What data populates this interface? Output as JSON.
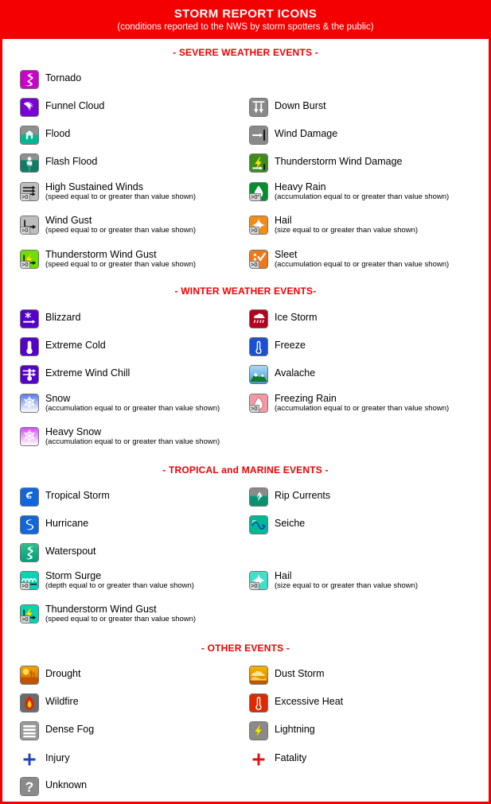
{
  "header": {
    "title": "STORM REPORT ICONS",
    "subtitle": "(conditions reported to the NWS by storm spotters & the public)",
    "bg_color": "#f40000",
    "text_color": "#ffffff"
  },
  "section_head_color": "#ee0000",
  "sections": [
    {
      "id": "severe",
      "heading": "- SEVERE WEATHER EVENTS -",
      "left": [
        {
          "name": "Tornado",
          "sub": "",
          "icon": "tornado",
          "value": null
        },
        {
          "name": "Funnel Cloud",
          "sub": "",
          "icon": "funnel-cloud",
          "value": null
        },
        {
          "name": "Flood",
          "sub": "",
          "icon": "flood",
          "value": null
        },
        {
          "name": "Flash Flood",
          "sub": "",
          "icon": "flash-flood",
          "value": null
        },
        {
          "name": "High Sustained Winds",
          "sub": "(speed equal to or greater than value shown)",
          "icon": "sustained-winds",
          "value": ">0"
        },
        {
          "name": "Wind Gust",
          "sub": "(speed equal to or greater than value shown)",
          "icon": "wind-gust",
          "value": ">0"
        },
        {
          "name": "Thunderstorm Wind Gust",
          "sub": "(speed equal to or greater than value shown)",
          "icon": "tstorm-wind-gust-green",
          "value": ">0"
        }
      ],
      "right": [
        {
          "name": "Down Burst",
          "sub": "",
          "icon": "down-burst",
          "value": null
        },
        {
          "name": "Wind Damage",
          "sub": "",
          "icon": "wind-damage",
          "value": null
        },
        {
          "name": "Thunderstorm Wind Damage",
          "sub": "",
          "icon": "tstorm-wind-damage",
          "value": null
        },
        {
          "name": "Heavy Rain",
          "sub": "(accumulation equal to or greater than value shown)",
          "icon": "heavy-rain",
          "value": ">0\""
        },
        {
          "name": "Hail",
          "sub": "(size equal to or greater than value shown)",
          "icon": "hail-orange",
          "value": ">0"
        },
        {
          "name": "Sleet",
          "sub": "(accumulation equal to or greater than value shown)",
          "icon": "sleet",
          "value": ">0"
        }
      ]
    },
    {
      "id": "winter",
      "heading": "- WINTER WEATHER EVENTS-",
      "left": [
        {
          "name": "Blizzard",
          "sub": "",
          "icon": "blizzard",
          "value": null
        },
        {
          "name": "Extreme Cold",
          "sub": "",
          "icon": "extreme-cold",
          "value": null
        },
        {
          "name": "Extreme Wind Chill",
          "sub": "",
          "icon": "wind-chill",
          "value": null
        },
        {
          "name": "Snow",
          "sub": "(accumulation equal to or greater than value shown)",
          "icon": "snow",
          "value": null
        },
        {
          "name": "Heavy Snow",
          "sub": "(accumulation equal to or greater than value shown)",
          "icon": "heavy-snow",
          "value": null
        }
      ],
      "right": [
        {
          "name": "Ice Storm",
          "sub": "",
          "icon": "ice-storm",
          "value": null
        },
        {
          "name": "Freeze",
          "sub": "",
          "icon": "freeze",
          "value": null
        },
        {
          "name": "Avalache",
          "sub": "",
          "icon": "avalanche",
          "value": null
        },
        {
          "name": "Freezing Rain",
          "sub": "(accumulation equal to or greater than value shown)",
          "icon": "freezing-rain",
          "value": ">0"
        }
      ]
    },
    {
      "id": "tropical",
      "heading": "- TROPICAL and MARINE EVENTS -",
      "left": [
        {
          "name": "Tropical Storm",
          "sub": "",
          "icon": "tropical-storm",
          "value": null
        },
        {
          "name": "Hurricane",
          "sub": "",
          "icon": "hurricane",
          "value": null
        },
        {
          "name": "Waterspout",
          "sub": "",
          "icon": "waterspout",
          "value": null
        },
        {
          "name": "Storm Surge",
          "sub": "(depth equal to or greater than value shown)",
          "icon": "storm-surge",
          "value": ">0"
        },
        {
          "name": "Thunderstorm Wind Gust",
          "sub": "(speed equal to or greater than value shown)",
          "icon": "tstorm-wind-gust-teal",
          "value": ">0"
        }
      ],
      "right": [
        {
          "name": "Rip Currents",
          "sub": "",
          "icon": "rip-currents",
          "value": null
        },
        {
          "name": "Seiche",
          "sub": "",
          "icon": "seiche",
          "value": null
        },
        {
          "name": "Hail",
          "sub": "(size equal to or greater than value shown)",
          "icon": "hail-teal",
          "value": ">0"
        }
      ]
    },
    {
      "id": "other",
      "heading": "- OTHER EVENTS -",
      "left": [
        {
          "name": "Drought",
          "sub": "",
          "icon": "drought",
          "value": null
        },
        {
          "name": "Wildfire",
          "sub": "",
          "icon": "wildfire",
          "value": null
        },
        {
          "name": "Dense Fog",
          "sub": "",
          "icon": "dense-fog",
          "value": null
        },
        {
          "name": "Injury",
          "sub": "",
          "icon": "injury",
          "value": null
        },
        {
          "name": "Unknown",
          "sub": "",
          "icon": "unknown",
          "value": null
        }
      ],
      "right": [
        {
          "name": "Dust Storm",
          "sub": "",
          "icon": "dust-storm",
          "value": null
        },
        {
          "name": "Excessive Heat",
          "sub": "",
          "icon": "excessive-heat",
          "value": null
        },
        {
          "name": "Lightning",
          "sub": "",
          "icon": "lightning",
          "value": null
        },
        {
          "name": "Fatality",
          "sub": "",
          "icon": "fatality",
          "value": null
        }
      ]
    }
  ],
  "palette": {
    "tornado_magenta": "#cc00cc",
    "funnel_purple": "#7700cc",
    "flood_teal": "#00a080",
    "gray": "#888888",
    "green": "#66dd00",
    "dark_green": "#007a28",
    "orange": "#f08000",
    "purple": "#5500cc",
    "blue": "#1155dd",
    "pink": "#f08090",
    "crimson": "#bb0022",
    "teal": "#00cfb0",
    "drought_orange": "#e08000",
    "red": "#dd2200",
    "yellow": "#f5e000"
  }
}
